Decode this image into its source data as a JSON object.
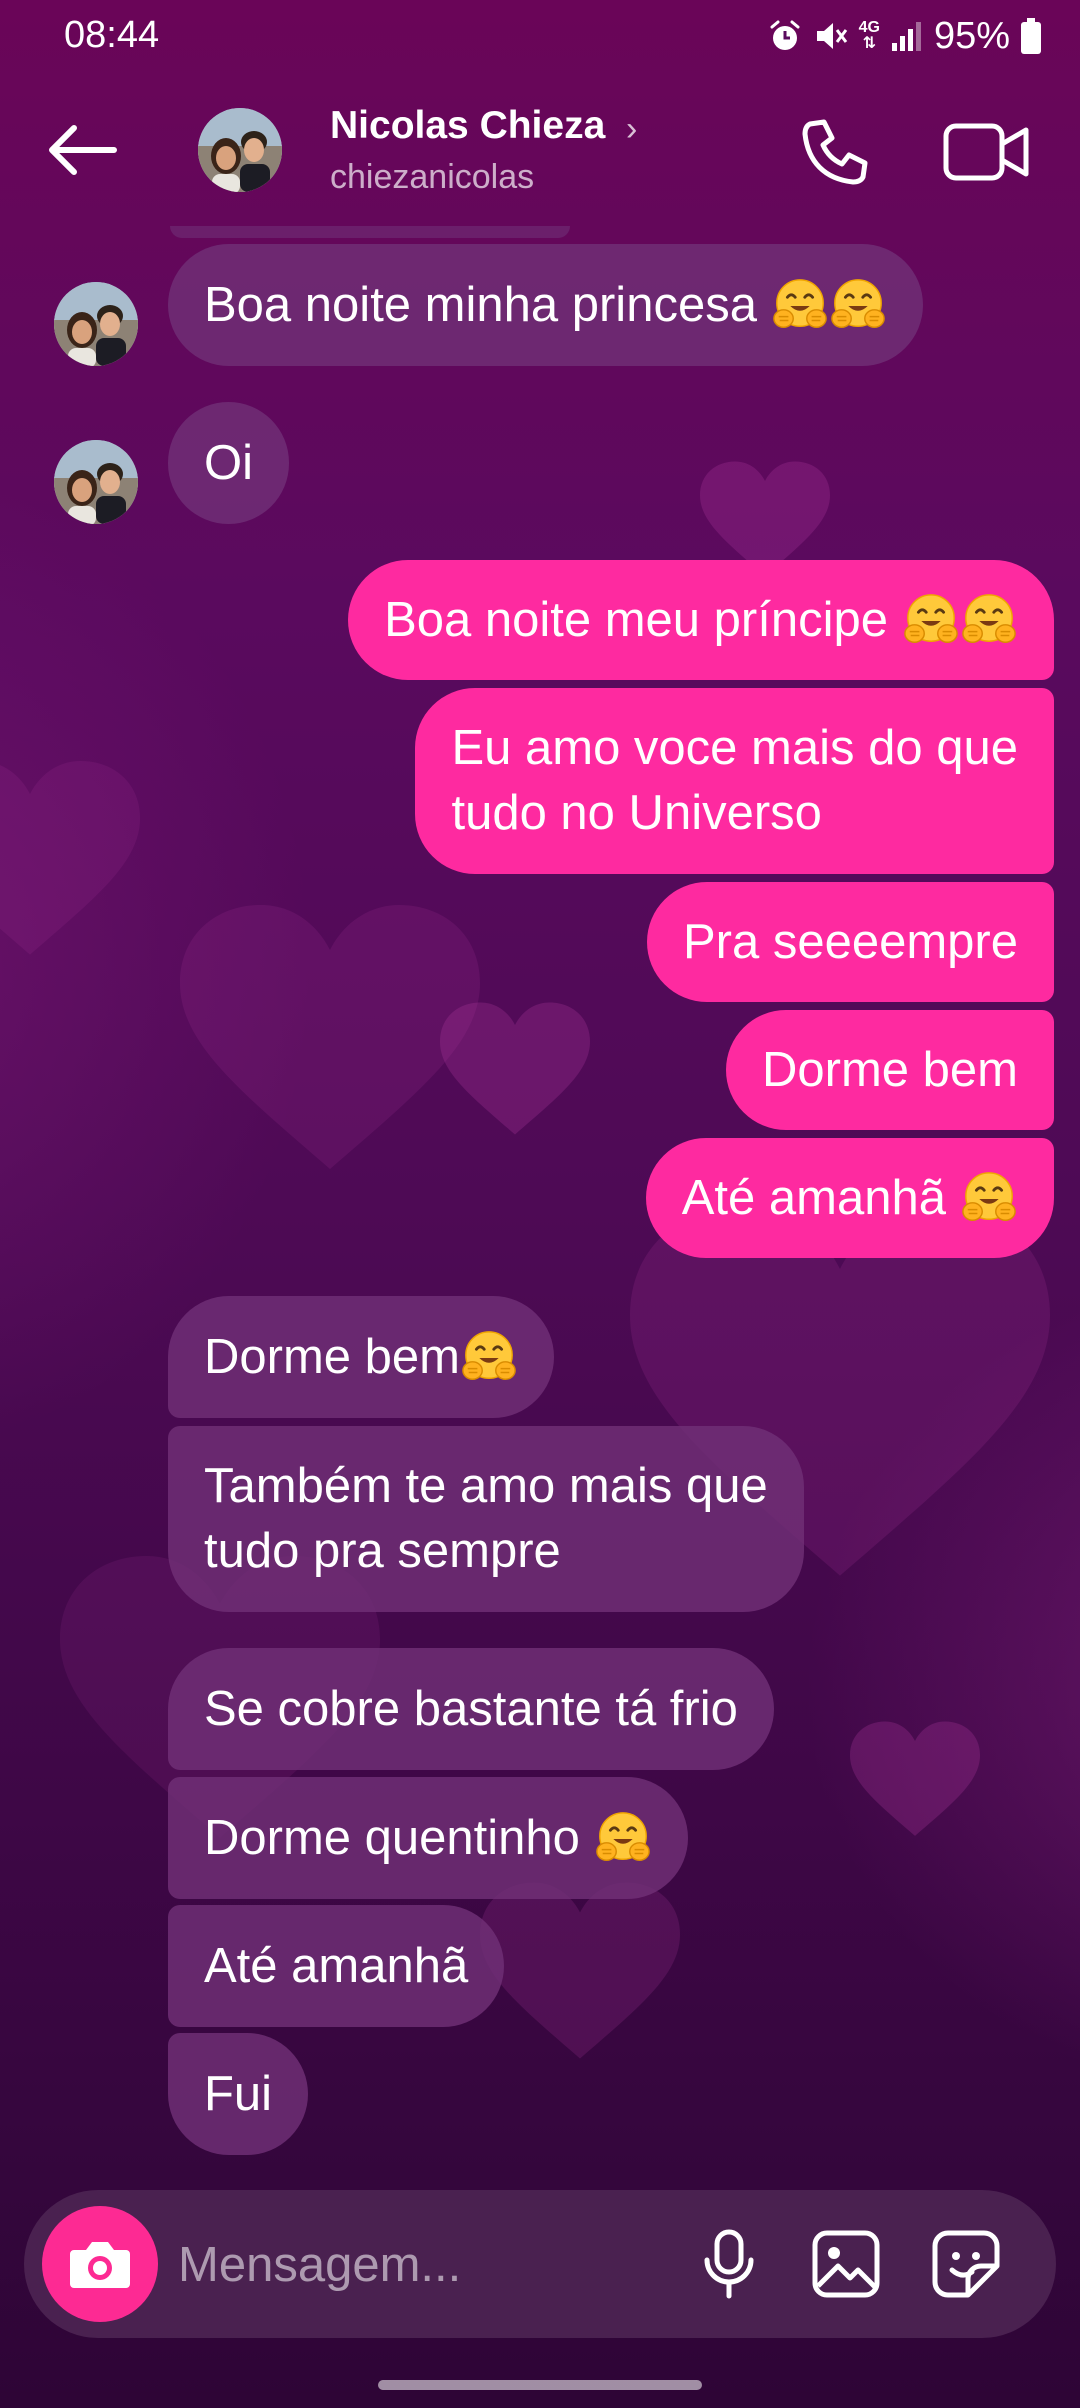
{
  "status_bar": {
    "time": "08:44",
    "network": "4G",
    "battery": "95%",
    "icons": [
      "alarm-icon",
      "mute-icon",
      "network-4g-icon",
      "signal-icon",
      "battery-icon"
    ]
  },
  "header": {
    "contact_name": "Nicolas Chieza",
    "username": "chiezanicolas",
    "chevron": "›",
    "icons": [
      "back-arrow-icon",
      "phone-icon",
      "video-camera-icon"
    ]
  },
  "messages": [
    {
      "direction": "incoming",
      "text": "Boa noite minha princesa",
      "emoji_count": 2,
      "avatar": true
    },
    {
      "direction": "incoming",
      "text": "Oi",
      "emoji_count": 0,
      "avatar": true
    },
    {
      "direction": "outgoing",
      "text": "Boa noite meu príncipe",
      "emoji_count": 2
    },
    {
      "direction": "outgoing",
      "lines": [
        "Eu amo voce mais do que",
        "tudo no Universo"
      ],
      "emoji_count": 0
    },
    {
      "direction": "outgoing",
      "text": "Pra seeeempre",
      "emoji_count": 0
    },
    {
      "direction": "outgoing",
      "text": "Dorme bem",
      "emoji_count": 0
    },
    {
      "direction": "outgoing",
      "text": "Até amanhã",
      "emoji_count": 1
    },
    {
      "direction": "incoming",
      "text": "Dorme bem",
      "emoji_count": 1
    },
    {
      "direction": "incoming",
      "lines": [
        "Também te amo mais que",
        "tudo pra sempre"
      ],
      "emoji_count": 0
    },
    {
      "direction": "incoming",
      "text": "Se cobre bastante tá frio",
      "emoji_count": 0
    },
    {
      "direction": "incoming",
      "text": "Dorme quentinho",
      "emoji_count": 1
    },
    {
      "direction": "incoming",
      "text": "Até amanhã",
      "emoji_count": 0
    },
    {
      "direction": "incoming",
      "text": "Fui",
      "emoji_count": 0
    }
  ],
  "composer": {
    "placeholder": "Mensagem...",
    "icons": [
      "camera-icon",
      "microphone-icon",
      "gallery-icon",
      "sticker-icon"
    ]
  },
  "colors": {
    "outgoing_bubble": "#fe2aa0",
    "incoming_bubble": "#703076",
    "camera_button": "#fd2a93",
    "background_top": "#6a0558",
    "background_bottom": "#2e0536"
  }
}
